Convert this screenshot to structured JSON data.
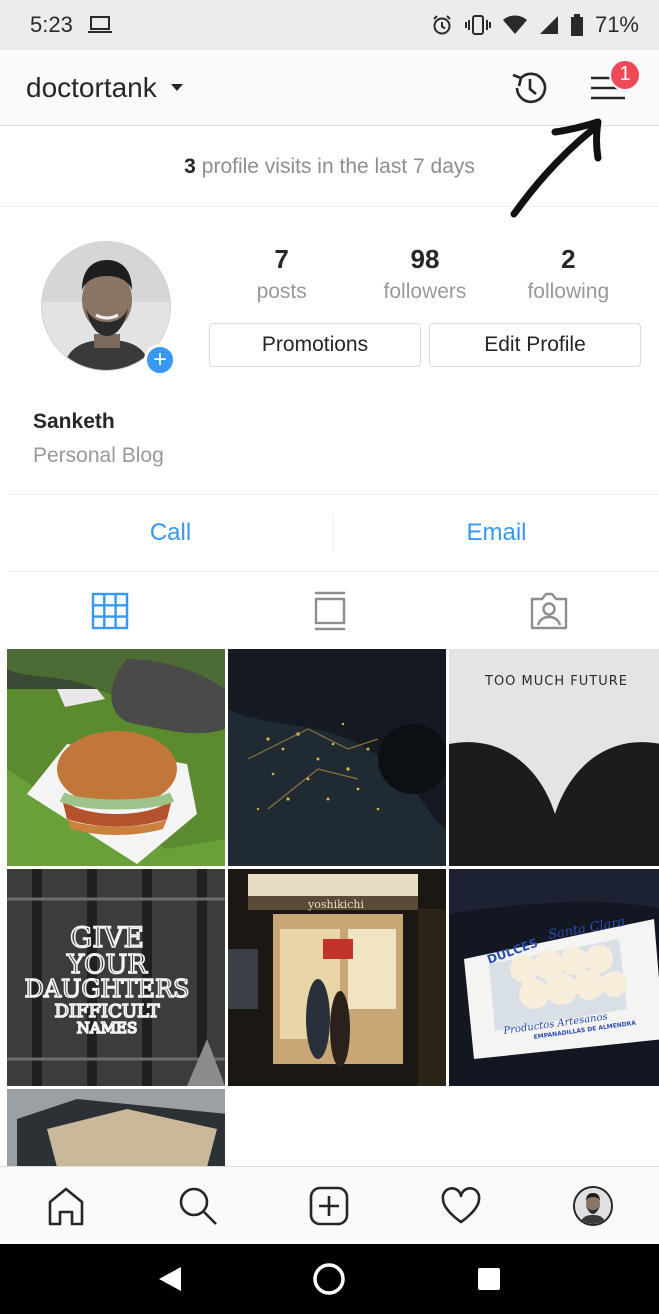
{
  "status_bar": {
    "time": "5:23",
    "battery": "71%",
    "icons": [
      "laptop-icon",
      "alarm-icon",
      "vibrate-icon",
      "wifi-icon",
      "signal-icon",
      "battery-icon"
    ]
  },
  "header": {
    "username": "doctortank",
    "notification_count": "1",
    "icons": [
      "chevron-down-icon",
      "history-icon",
      "menu-icon"
    ]
  },
  "visits": {
    "count": "3",
    "text": "profile visits in the last 7 days"
  },
  "profile": {
    "stats": [
      {
        "value": "7",
        "label": "posts"
      },
      {
        "value": "98",
        "label": "followers"
      },
      {
        "value": "2",
        "label": "following"
      }
    ],
    "buttons": {
      "promotions": "Promotions",
      "edit_profile": "Edit Profile"
    },
    "name": "Sanketh",
    "category": "Personal Blog"
  },
  "contact": {
    "call": "Call",
    "email": "Email"
  },
  "view_tabs": [
    {
      "icon": "grid-icon",
      "active": true
    },
    {
      "icon": "feed-icon",
      "active": false
    },
    {
      "icon": "tagged-icon",
      "active": false
    }
  ],
  "posts": {
    "tile_texts": {
      "too_much_future": "TOO MUCH FUTURE",
      "give_daughters": [
        "GIVE",
        "YOUR",
        "DAUGHTERS",
        "DIFFICULT",
        "NAMES"
      ],
      "sign": "yoshikichi",
      "dulces": "DULCES",
      "santa_clara": "Santa Clara",
      "productos": "Productos Artesanos",
      "empanadillas": "EMPANADILLAS DE ALMENDRA"
    }
  },
  "bottom_nav": [
    "home-icon",
    "search-icon",
    "add-post-icon",
    "heart-icon",
    "profile-avatar"
  ],
  "android_nav": [
    "back-icon",
    "home-circle-icon",
    "recents-icon"
  ],
  "colors": {
    "accent": "#3897f0",
    "badge": "#ed4956",
    "text": "#262626",
    "muted": "#999999"
  }
}
